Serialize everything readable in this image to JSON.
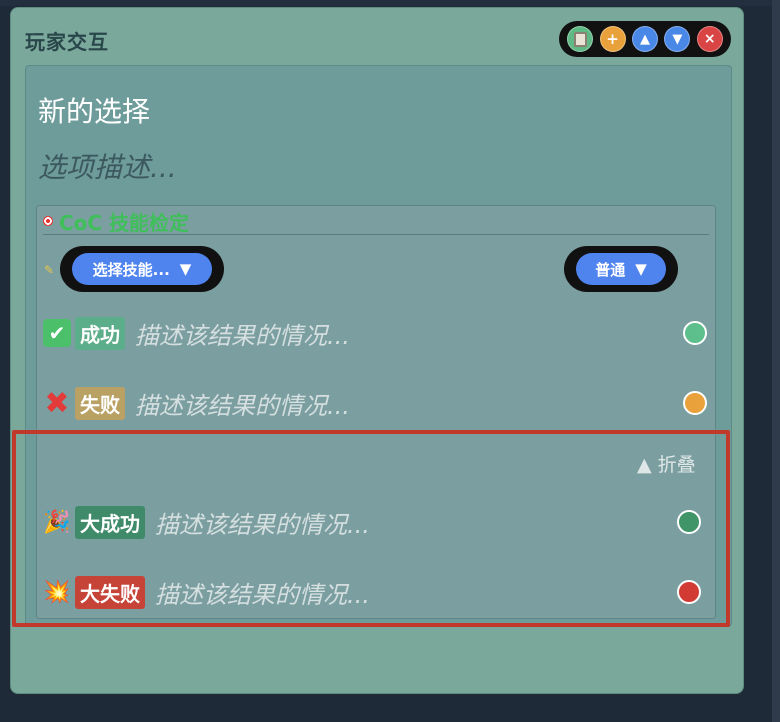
{
  "panel": {
    "title": "玩家交互"
  },
  "toolbar": {
    "copy_icon": "clipboard-icon",
    "add_label": "+",
    "up_label": "▲",
    "down_label": "▼",
    "close_label": "×"
  },
  "choice": {
    "title": "新的选择",
    "description_placeholder": "选项描述..."
  },
  "skill_check": {
    "header": "CoC 技能检定",
    "skill_select": "选择技能...",
    "difficulty_select": "普通",
    "dropdown_arrow": "▼",
    "outcomes": [
      {
        "emoji": "✔",
        "label": "成功",
        "placeholder": "描述该结果的情况...",
        "dot_color": "#5cbf8c"
      },
      {
        "emoji": "✖",
        "label": "失败",
        "placeholder": "描述该结果的情况...",
        "dot_color": "#e9a23b"
      },
      {
        "emoji": "🎉",
        "label": "大成功",
        "placeholder": "描述该结果的情况...",
        "dot_color": "#3f9468"
      },
      {
        "emoji": "💥",
        "label": "大失败",
        "placeholder": "描述该结果的情况...",
        "dot_color": "#d23b34"
      }
    ],
    "fold_label": "▲ 折叠"
  }
}
